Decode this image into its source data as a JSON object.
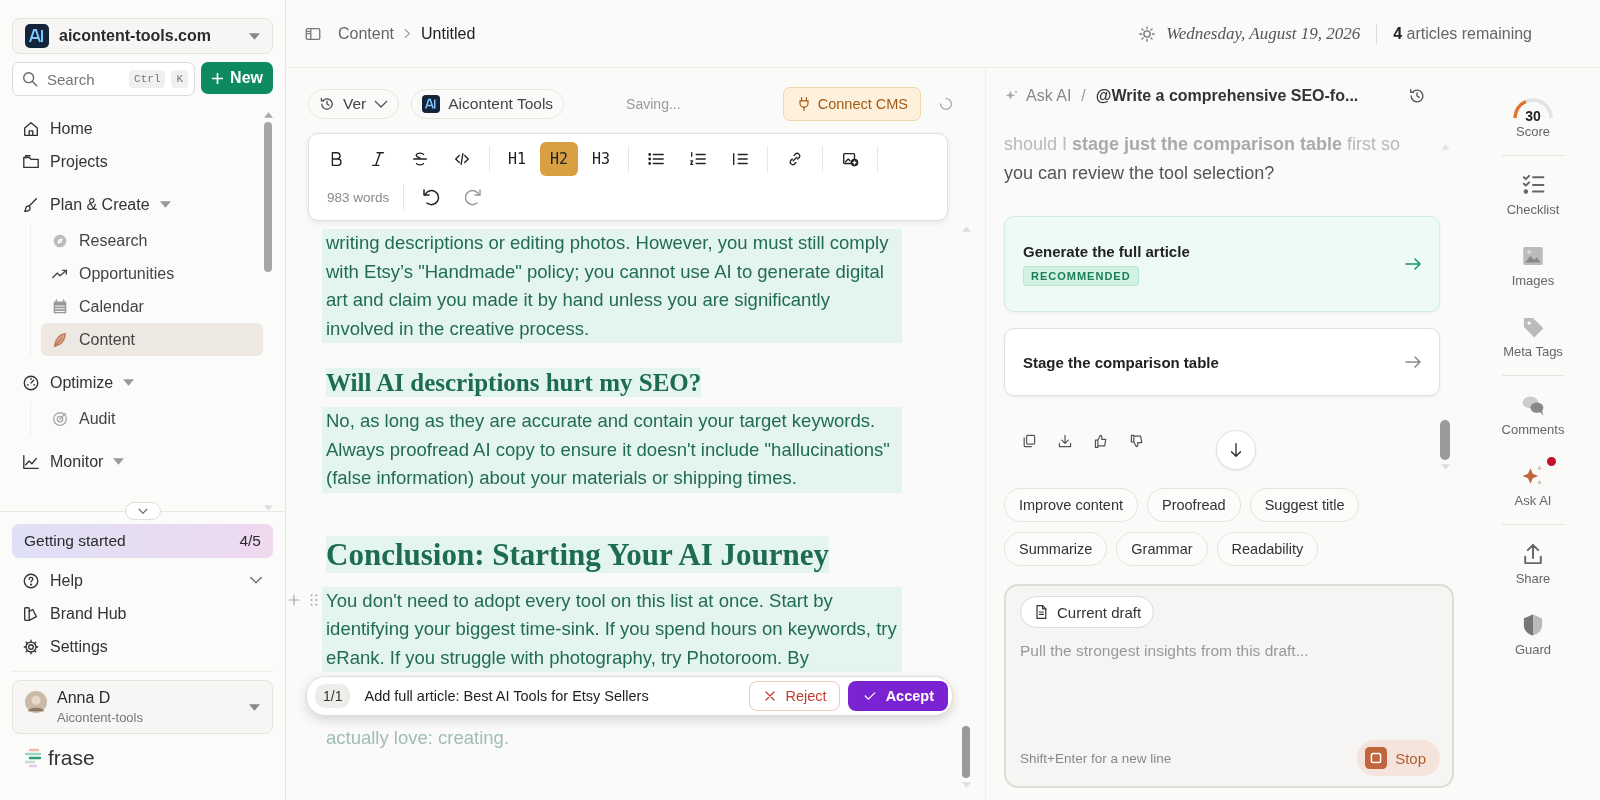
{
  "workspace": {
    "name": "aicontent-tools.com"
  },
  "search": {
    "placeholder": "Search",
    "keys": [
      "Ctrl",
      "K"
    ]
  },
  "new_button": "New",
  "nav": [
    {
      "label": "Home",
      "selected": false
    },
    {
      "label": "Projects",
      "selected": false
    },
    {
      "label": "Plan & Create",
      "selected": false,
      "expanded": true,
      "children": [
        {
          "label": "Research",
          "selected": false
        },
        {
          "label": "Opportunities",
          "selected": false
        },
        {
          "label": "Calendar",
          "selected": false
        },
        {
          "label": "Content",
          "selected": true
        }
      ]
    },
    {
      "label": "Optimize",
      "selected": false,
      "expanded": true,
      "children": [
        {
          "label": "Audit",
          "selected": false
        }
      ]
    },
    {
      "label": "Monitor",
      "selected": false,
      "expanded": true
    }
  ],
  "getting_started": {
    "label": "Getting started",
    "progress": "4/5"
  },
  "bottom_nav": [
    {
      "label": "Help",
      "expandable": true
    },
    {
      "label": "Brand Hub",
      "expandable": false
    },
    {
      "label": "Settings",
      "expandable": false
    }
  ],
  "user": {
    "name": "Anna D",
    "org": "Aicontent-tools"
  },
  "logo": "frase",
  "breadcrumb": [
    "Content",
    "Untitled"
  ],
  "date": "Wednesday, August 19, 2026",
  "remaining": "**4** articles remaining",
  "editor_bar": {
    "version": "Ver",
    "brand": "Aicontent Tools",
    "status": "Saving...",
    "connect": "Connect CMS"
  },
  "toolbar": {
    "headings": [
      {
        "label": "H1",
        "selected": false
      },
      {
        "label": "H2",
        "selected": true
      },
      {
        "label": "H3",
        "selected": false
      }
    ],
    "word_count": "983 words"
  },
  "content": [
    {
      "kind": "paragraph",
      "text": "writing descriptions or editing photos. However, you must still comply with Etsy’s \"Handmade\" policy; you cannot use AI to generate digital art and claim you made it by hand unless you are significantly involved in the creative process."
    },
    {
      "kind": "h3",
      "text": "Will AI descriptions hurt my SEO?"
    },
    {
      "kind": "paragraph",
      "text": "No, as long as they are accurate and contain your target keywords. Always proofread AI copy to ensure it doesn't include \"hallucinations\" (false information) about your materials or shipping times."
    },
    {
      "kind": "h2",
      "text": "Conclusion: Starting Your AI Journey"
    },
    {
      "kind": "paragraph",
      "text": "You don't need to adopt every tool on this list at once. Start by identifying your biggest time-sink. If you spend hours on keywords, try eRank. If you struggle with photography, try Photoroom. By"
    },
    {
      "kind": "faded",
      "text": "actually love: creating."
    }
  ],
  "review": {
    "count": "1/1",
    "text": "Add full article: Best AI Tools for Etsy Sellers",
    "reject": "Reject",
    "accept": "Accept"
  },
  "ask": {
    "label": "Ask AI",
    "separator": "/",
    "prompt": "@Write a comprehensive SEO-fo...",
    "message": "should I **stage just the comparison table** first so",
    "message_2": "you can review the tool selection?",
    "options": [
      {
        "label": "Generate the full article",
        "badge": "RECOMMENDED",
        "selected": true
      },
      {
        "label": "Stage the comparison table",
        "selected": false
      }
    ],
    "chips": [
      "Improve content",
      "Proofread",
      "Suggest title",
      "Summarize",
      "Grammar",
      "Readability"
    ],
    "draft_chip": "Current draft",
    "placeholder": "Pull the strongest insights from this draft...",
    "hint": "Shift+Enter for a new line",
    "stop": "Stop"
  },
  "rail": [
    {
      "label": "Score",
      "value": "30",
      "level": 0.3
    },
    {
      "label": "Checklist"
    },
    {
      "label": "Images"
    },
    {
      "label": "Meta Tags"
    },
    {
      "label": "Comments"
    },
    {
      "label": "Ask AI",
      "notification": true
    },
    {
      "label": "Share"
    },
    {
      "label": "Guard"
    }
  ]
}
